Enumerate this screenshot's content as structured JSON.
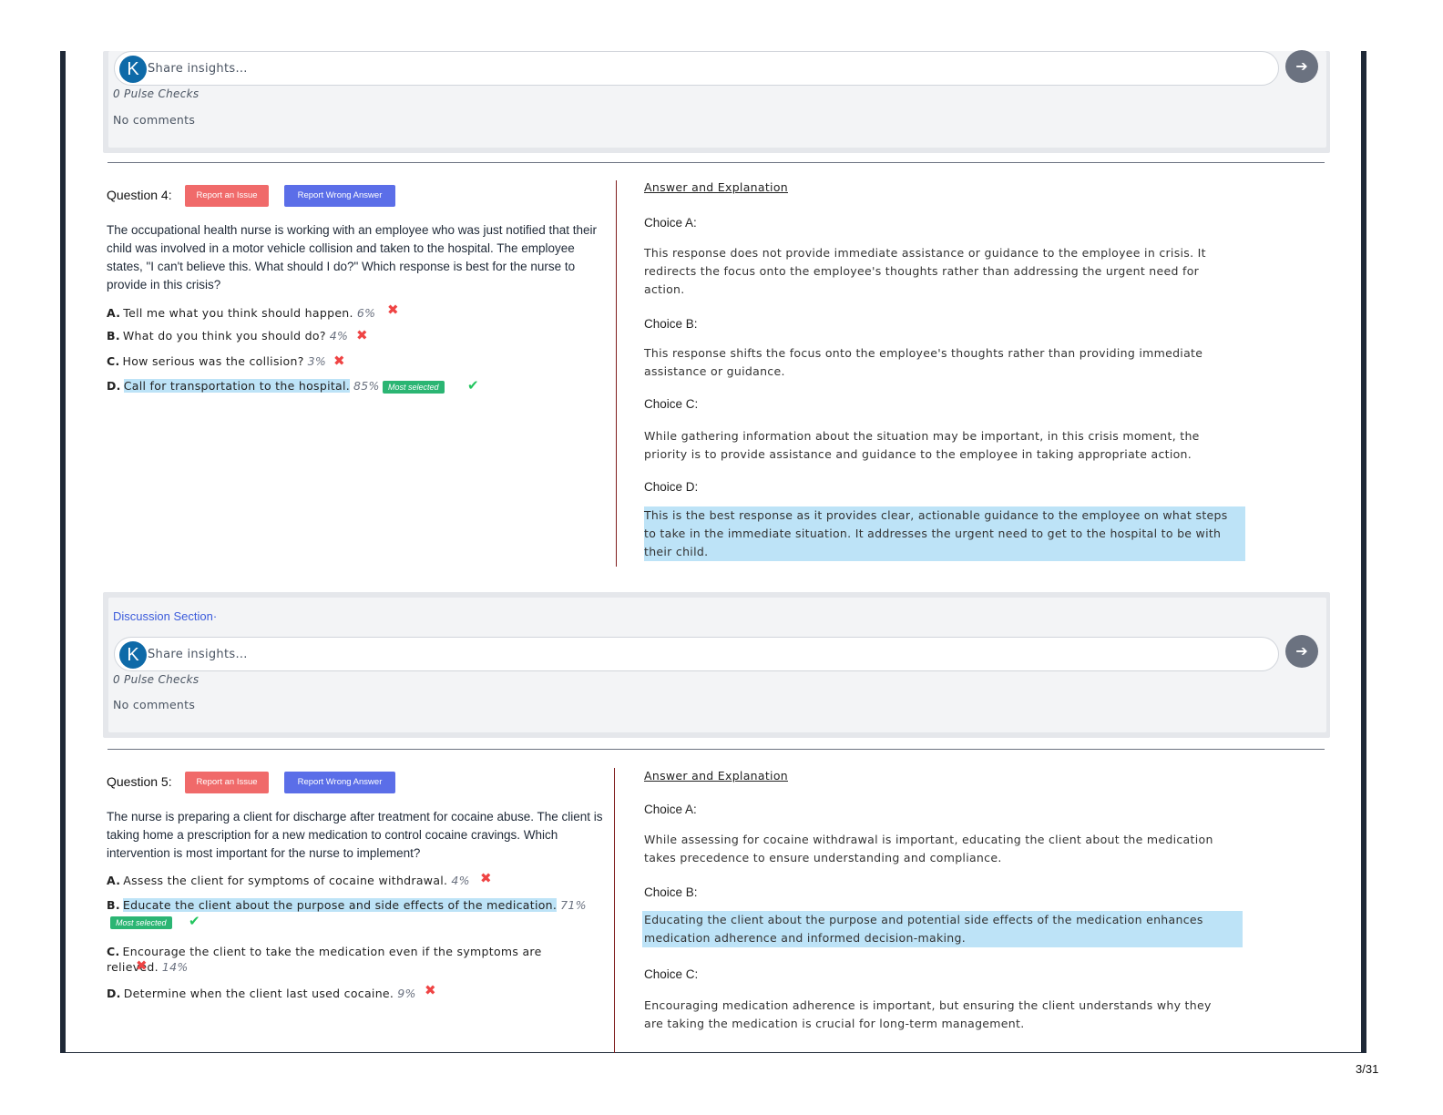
{
  "discussion_common": {
    "placeholder": "Share insights...",
    "avatar_letter": "K",
    "send_symbol": "➔",
    "pulse_checks": "0 Pulse Checks",
    "no_comments": "No comments"
  },
  "discussion_2": {
    "title": "Discussion Section·"
  },
  "buttons": {
    "report_issue": "Report an Issue",
    "report_wrong": "Report Wrong Answer"
  },
  "symbols": {
    "x": "✖",
    "check": "✔"
  },
  "answer_heading": "Answer and Explanation",
  "q4": {
    "label": "Question 4:",
    "text": "The occupational health nurse is working with an employee who was just notified that their child was involved in a motor vehicle collision and taken to the hospital. The employee states, \"I can't believe this. What should I do?\" Which response is best for the nurse to provide in this crisis?",
    "options": [
      {
        "letter": "A.",
        "text": "Tell me what you think should happen.",
        "pct": "6%"
      },
      {
        "letter": "B.",
        "text": "What do you think you should do?",
        "pct": "4%"
      },
      {
        "letter": "C.",
        "text": "How serious was the collision?",
        "pct": "3%"
      },
      {
        "letter": "D.",
        "text": "Call for transportation to the hospital.",
        "pct": "85%",
        "badge": "Most selected"
      }
    ],
    "choices": [
      {
        "label": "Choice A:",
        "text": "This response does not provide immediate assistance or guidance to the employee in crisis. It redirects the focus onto the employee's thoughts rather than addressing the urgent need for action."
      },
      {
        "label": "Choice B:",
        "text": "This response shifts the focus onto the employee's thoughts rather than providing immediate assistance or guidance."
      },
      {
        "label": "Choice C:",
        "text": "While gathering information about the situation may be important, in this crisis moment, the priority is to provide assistance and guidance to the employee in taking appropriate action."
      },
      {
        "label": "Choice D:",
        "text": "This is the best response as it provides clear, actionable guidance to the employee on what steps to take in the immediate situation. It addresses the urgent need to get to the hospital to be with their child."
      }
    ]
  },
  "q5": {
    "label": "Question 5:",
    "text": "The nurse is preparing a client for discharge after treatment for cocaine abuse. The client is taking home a prescription for a new medication to control cocaine cravings. Which intervention is most important for the nurse to implement?",
    "options": [
      {
        "letter": "A.",
        "text": "Assess the client for symptoms of cocaine withdrawal.",
        "pct": "4%"
      },
      {
        "letter": "B.",
        "text": "Educate the client about the purpose and side effects of the medication.",
        "pct": "71%",
        "badge": "Most selected"
      },
      {
        "letter": "C.",
        "text": "Encourage the client to take the medication even if the symptoms are relieved.",
        "pct": "14%"
      },
      {
        "letter": "D.",
        "text": "Determine when the client last used cocaine.",
        "pct": "9%"
      }
    ],
    "choices": [
      {
        "label": "Choice A:",
        "text": "While assessing for cocaine withdrawal is important, educating the client about the medication takes precedence to ensure understanding and compliance."
      },
      {
        "label": "Choice B:",
        "text": "Educating the client about the purpose and potential side effects of the medication enhances medication adherence and informed decision-making."
      },
      {
        "label": "Choice C:",
        "text": "Encouraging medication adherence is important, but ensuring the client understands why they are taking the medication is crucial for long-term management."
      }
    ]
  },
  "page_number": "3/31"
}
